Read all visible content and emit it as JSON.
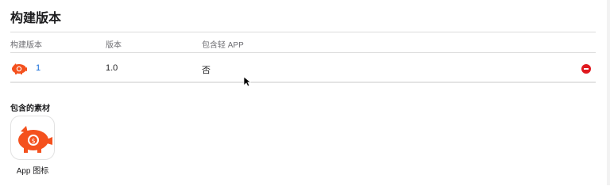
{
  "section": {
    "title": "构建版本"
  },
  "table": {
    "headers": [
      "构建版本",
      "版本",
      "包含轻 APP"
    ],
    "rows": [
      {
        "build": "1",
        "version": "1.0",
        "includes_app_clip": "否",
        "icon": "piggy-bank-icon",
        "action_icon": "remove-icon"
      }
    ]
  },
  "assets": {
    "title": "包含的素材",
    "items": [
      {
        "label": "App 图标",
        "icon": "piggy-bank-icon"
      }
    ]
  },
  "colors": {
    "brand_orange": "#f4511e",
    "link_blue": "#0a66d8",
    "remove_red": "#e0191f"
  }
}
